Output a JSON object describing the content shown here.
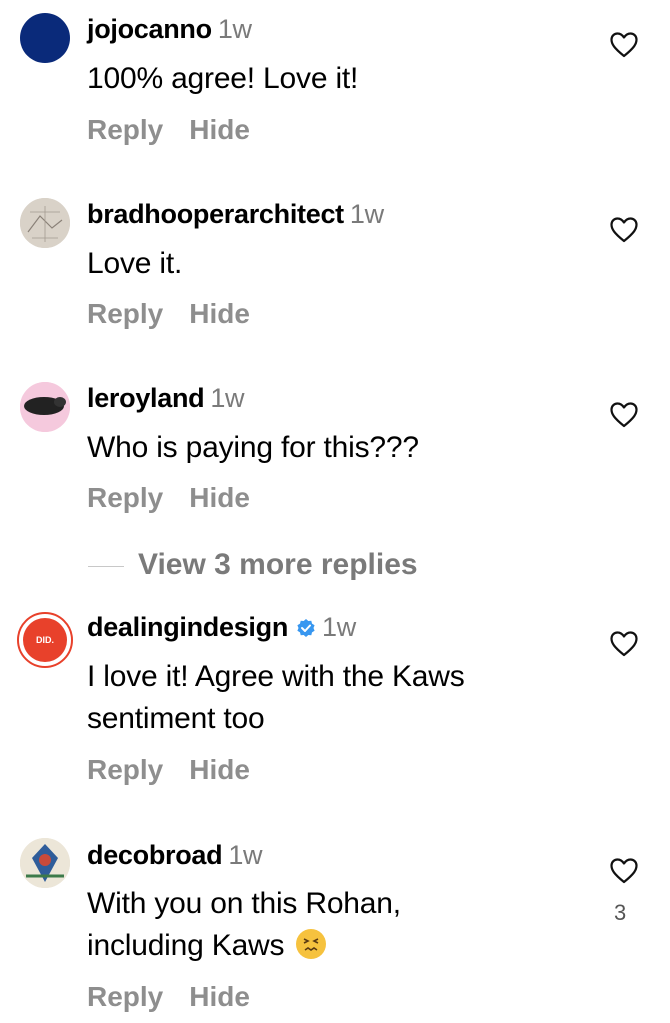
{
  "comments": [
    {
      "username": "jojocanno",
      "time": "1w",
      "text": "100% agree! Love it!",
      "reply_label": "Reply",
      "hide_label": "Hide",
      "avatar_color": "#0a2a7a"
    },
    {
      "username": "bradhooperarchitect",
      "time": "1w",
      "text": "Love it.",
      "reply_label": "Reply",
      "hide_label": "Hide"
    },
    {
      "username": "leroyland",
      "time": "1w",
      "text": "Who is paying for this???",
      "reply_label": "Reply",
      "hide_label": "Hide"
    },
    {
      "username": "dealingindesign",
      "time": "1w",
      "verified": true,
      "avatar_label": "DID.",
      "text_line1": "I love it! Agree with the Kaws",
      "text_line2": "sentiment too",
      "reply_label": "Reply",
      "hide_label": "Hide",
      "avatar_ring_color": "#e8412b"
    },
    {
      "username": "decobroad",
      "time": "1w",
      "text_line1": "With you on this Rohan,",
      "text_line2": "including Kaws",
      "emoji": "confounded-face",
      "like_count": "3",
      "reply_label": "Reply",
      "hide_label": "Hide"
    }
  ],
  "view_more_replies": "View 3 more replies",
  "colors": {
    "secondary_text": "#8e8e8e",
    "verified_blue": "#3897f0"
  }
}
